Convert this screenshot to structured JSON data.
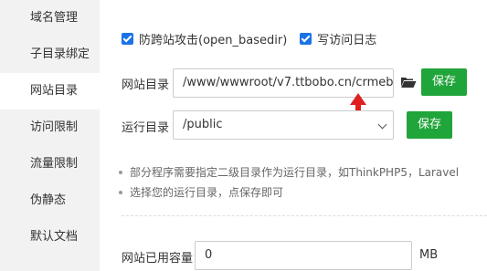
{
  "sidebar": {
    "items": [
      {
        "label": "域名管理"
      },
      {
        "label": "子目录绑定"
      },
      {
        "label": "网站目录"
      },
      {
        "label": "访问限制"
      },
      {
        "label": "流量限制"
      },
      {
        "label": "伪静态"
      },
      {
        "label": "默认文档"
      }
    ],
    "active_index": 2
  },
  "options": {
    "anti_xss_label": "防跨站攻击(open_basedir)",
    "anti_xss_checked": true,
    "access_log_label": "写访问日志",
    "access_log_checked": true
  },
  "site_dir": {
    "label": "网站目录",
    "value": "/www/wwwroot/v7.ttbobo.cn/crmeb",
    "folder_icon": "folder-open-icon",
    "save_label": "保存"
  },
  "run_dir": {
    "label": "运行目录",
    "value": "/public",
    "save_label": "保存"
  },
  "hints": [
    "部分程序需要指定二级目录作为运行目录，如ThinkPHP5，Laravel",
    "选择您的运行目录，点保存即可"
  ],
  "capacity": {
    "label": "网站已用容量",
    "value": "0",
    "unit": "MB"
  },
  "colors": {
    "save_button": "#20a53a",
    "checkbox": "#1a73e8",
    "arrow_annotation": "#e02020"
  }
}
